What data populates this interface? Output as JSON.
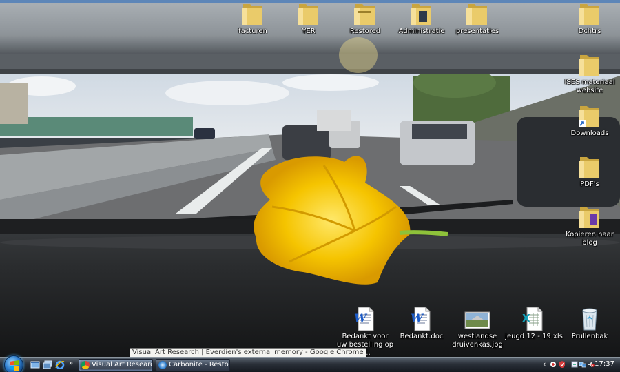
{
  "desktop": {
    "icons_top": [
      {
        "label": "facturen"
      },
      {
        "label": "YER"
      },
      {
        "label": "Restored"
      },
      {
        "label": "Administratie"
      },
      {
        "label": "presentaties"
      }
    ],
    "icons_right": [
      {
        "label": "Dchtrs"
      },
      {
        "label": "ISES materiaal website"
      },
      {
        "label": "Downloads"
      },
      {
        "label": "PDF's"
      },
      {
        "label": "Kopieren naar blog"
      }
    ],
    "icons_bottom": [
      {
        "label": "Bedankt voor uw bestelling op k...",
        "type": "word-doc-icon"
      },
      {
        "label": "Bedankt.doc",
        "type": "word-doc-icon"
      },
      {
        "label": "westlandse druivenkas.jpg",
        "type": "image-file-icon"
      },
      {
        "label": "jeugd 12 - 19.xls",
        "type": "excel-file-icon"
      },
      {
        "label": "Prullenbak",
        "type": "recycle-bin-icon"
      }
    ]
  },
  "tooltip": {
    "text": "Visual Art Research | Everdien's external memory - Google Chrome"
  },
  "taskbar": {
    "quick_launch_chevron": "»",
    "buttons": [
      {
        "label": "Visual Art Research |...",
        "icon": "chrome-icon"
      },
      {
        "label": "Carbonite - Restore ...",
        "icon": "carbonite-icon"
      }
    ],
    "tray_chevron": "‹",
    "clock": "17:37"
  },
  "colors": {
    "folder": "#e9c765",
    "taskbar": "#2a3038",
    "flower": "#f5c400"
  }
}
